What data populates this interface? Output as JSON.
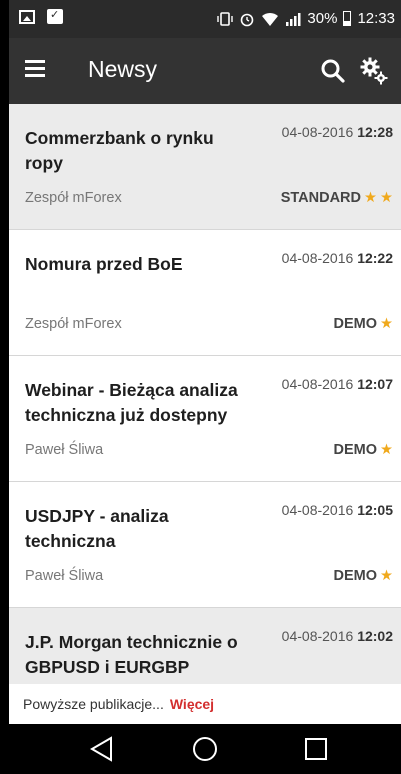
{
  "status_bar": {
    "battery_percent": "30%",
    "time": "12:33",
    "icons": [
      "image-icon",
      "bag-check-icon",
      "vibrate-icon",
      "alarm-icon",
      "wifi-icon",
      "signal-icon",
      "battery-icon"
    ]
  },
  "app_bar": {
    "title": "Newsy",
    "icons": [
      "menu-icon",
      "search-icon",
      "settings-icon"
    ]
  },
  "news": [
    {
      "title": "Commerzbank o rynku ropy",
      "date": "04-08-2016",
      "time": "12:28",
      "author": "Zespół mForex",
      "badge": "STANDARD",
      "stars": 2,
      "read": true
    },
    {
      "title": "Nomura przed BoE",
      "date": "04-08-2016",
      "time": "12:22",
      "author": "Zespół mForex",
      "badge": "DEMO",
      "stars": 1,
      "read": false
    },
    {
      "title": "Webinar - Bieżąca analiza techniczna już dostepny",
      "date": "04-08-2016",
      "time": "12:07",
      "author": "Paweł Śliwa",
      "badge": "DEMO",
      "stars": 1,
      "read": false
    },
    {
      "title": "USDJPY - analiza techniczna",
      "date": "04-08-2016",
      "time": "12:05",
      "author": "Paweł Śliwa",
      "badge": "DEMO",
      "stars": 1,
      "read": false
    },
    {
      "title": "J.P. Morgan technicznie o GBPUSD i EURGBP",
      "date": "04-08-2016",
      "time": "12:02",
      "read": true
    }
  ],
  "notice": {
    "text": "Powyższe publikacje...",
    "more": "Więcej"
  },
  "colors": {
    "star": "#f0a91c",
    "more_link": "#d32f2f",
    "app_bar": "#333333"
  }
}
